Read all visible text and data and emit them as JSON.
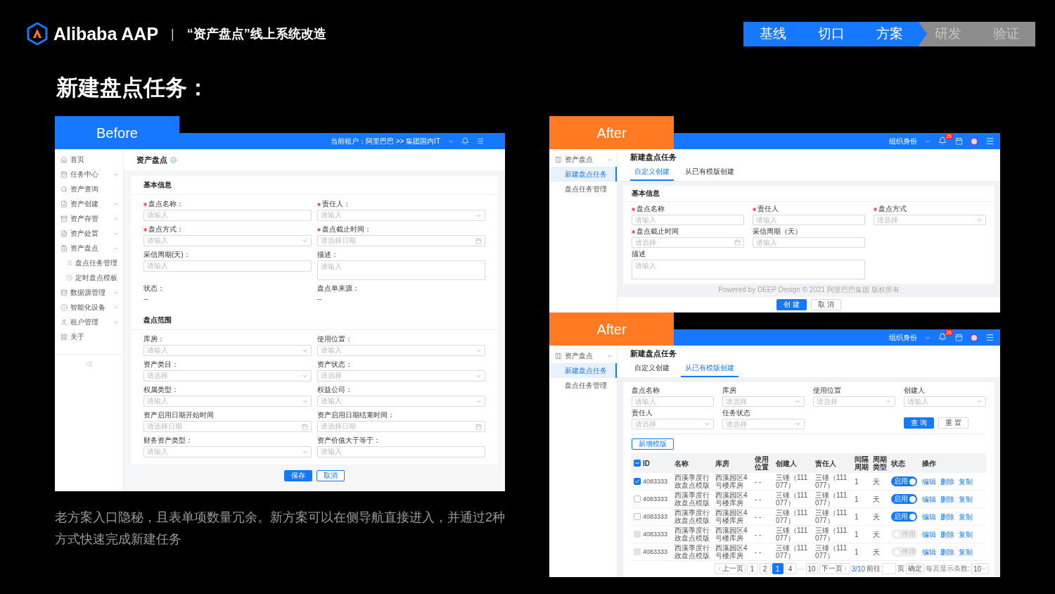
{
  "header": {
    "brand": "Alibaba AAP",
    "separator": "|",
    "project": "“资产盘点”线上系统改造",
    "steps": [
      {
        "label": "基线",
        "active": true
      },
      {
        "label": "切口",
        "active": true
      },
      {
        "label": "方案",
        "active": true
      },
      {
        "label": "研发",
        "active": false
      },
      {
        "label": "验证",
        "active": false
      }
    ]
  },
  "title": "新建盘点任务：",
  "before": {
    "badge": "Before",
    "tenant": "当前租户：阿里巴巴 >> 集团国内IT",
    "sidebar": [
      {
        "label": "首页",
        "kind": "link"
      },
      {
        "label": "任务中心",
        "kind": "group",
        "expanded": false
      },
      {
        "label": "资产查询",
        "kind": "link"
      },
      {
        "label": "资产创建",
        "kind": "group",
        "expanded": false
      },
      {
        "label": "资产存管",
        "kind": "group",
        "expanded": false
      },
      {
        "label": "资产处置",
        "kind": "group",
        "expanded": false
      },
      {
        "label": "资产盘点",
        "kind": "group",
        "expanded": true,
        "children": [
          {
            "label": "盘点任务管理",
            "kind": "link"
          },
          {
            "label": "定时盘点模板",
            "kind": "link"
          }
        ]
      },
      {
        "label": "数据源管理",
        "kind": "group",
        "expanded": false
      },
      {
        "label": "智能化设备",
        "kind": "group",
        "expanded": false
      },
      {
        "label": "租户管理",
        "kind": "group",
        "expanded": false
      },
      {
        "label": "关于",
        "kind": "link"
      }
    ],
    "page_title": "资产盘点",
    "sections": [
      {
        "title": "基本信息",
        "fields": [
          {
            "label": "盘点名称：",
            "required": true,
            "kind": "input",
            "placeholder": "请输入"
          },
          {
            "label": "责任人：",
            "required": true,
            "kind": "select",
            "placeholder": "请输入"
          },
          {
            "label": "盘点方式：",
            "required": true,
            "kind": "select",
            "placeholder": "请输入"
          },
          {
            "label": "盘点截止时间：",
            "required": true,
            "kind": "date",
            "placeholder": "请选择日期"
          },
          {
            "label": "采信周期(天)：",
            "required": false,
            "kind": "input",
            "placeholder": "请输入"
          },
          {
            "label": "描述：",
            "required": false,
            "kind": "textarea",
            "placeholder": "请输入"
          },
          {
            "label": "状态：",
            "required": false,
            "kind": "static",
            "value": "--"
          },
          {
            "label": "盘点单来源：",
            "required": false,
            "kind": "static",
            "value": "--"
          }
        ]
      },
      {
        "title": "盘点范围",
        "fields": [
          {
            "label": "库房：",
            "required": false,
            "kind": "select",
            "placeholder": "请输入"
          },
          {
            "label": "使用位置：",
            "required": false,
            "kind": "select",
            "placeholder": "请输入"
          },
          {
            "label": "资产类目：",
            "required": false,
            "kind": "select",
            "placeholder": "请选择"
          },
          {
            "label": "资产状态：",
            "required": false,
            "kind": "select",
            "placeholder": "请选择"
          },
          {
            "label": "权属类型：",
            "required": false,
            "kind": "select",
            "placeholder": "请输入"
          },
          {
            "label": "权益公司：",
            "required": false,
            "kind": "select",
            "placeholder": "请输入"
          },
          {
            "label": "资产启用日期开始时间",
            "required": false,
            "kind": "date",
            "placeholder": "请选择日期"
          },
          {
            "label": "资产启用日期结束时间：",
            "required": false,
            "kind": "date",
            "placeholder": "请选择日期"
          },
          {
            "label": "财务资产类型：",
            "required": false,
            "kind": "select",
            "placeholder": "请输入"
          },
          {
            "label": "资产价值大于等于：",
            "required": false,
            "kind": "input",
            "placeholder": "请输入"
          }
        ]
      }
    ],
    "buttons": [
      {
        "label": "保存",
        "primary": true
      },
      {
        "label": "取消",
        "primary": false
      }
    ]
  },
  "caption": "老方案入口隐秘，且表单项数量冗余。新方案可以在侧导航直接进入，并通过2种方式快速完成新建任务",
  "after_custom": {
    "badge": "After",
    "org": "组织身份",
    "notifications": "26",
    "sidebar": [
      {
        "label": "资产盘点",
        "kind": "group",
        "expanded": true,
        "children": [
          {
            "label": "新建盘点任务",
            "kind": "link",
            "selected": true
          },
          {
            "label": "盘点任务管理",
            "kind": "link",
            "selected": false
          }
        ]
      }
    ],
    "page_title": "新建盘点任务",
    "tabs": [
      {
        "label": "自定义创建",
        "selected": true
      },
      {
        "label": "从已有模版创建",
        "selected": false
      }
    ],
    "section_title": "基本信息",
    "fields": [
      {
        "label": "盘点名称",
        "required": true,
        "kind": "input",
        "placeholder": "请输入"
      },
      {
        "label": "责任人",
        "required": true,
        "kind": "input",
        "placeholder": "请输入"
      },
      {
        "label": "盘点方式",
        "required": true,
        "kind": "select",
        "placeholder": "请选择"
      },
      {
        "label": "盘点截止时间",
        "required": true,
        "kind": "date",
        "placeholder": "请选择"
      },
      {
        "label": "采信周期（天）",
        "required": false,
        "kind": "input",
        "placeholder": "请输入"
      },
      {
        "label": "描述",
        "required": false,
        "kind": "textarea",
        "placeholder": "请输入"
      }
    ],
    "footer": "Powered by  DEEP Design © 2021 阿里巴巴集团 版权所有",
    "buttons": [
      {
        "label": "创 建",
        "primary": true
      },
      {
        "label": "取 消",
        "primary": false
      }
    ]
  },
  "after_template": {
    "badge": "After",
    "org": "组织身份",
    "notifications": "26",
    "sidebar": [
      {
        "label": "资产盘点",
        "kind": "group",
        "expanded": true,
        "children": [
          {
            "label": "新建盘点任务",
            "kind": "link",
            "selected": true
          },
          {
            "label": "盘点任务管理",
            "kind": "link",
            "selected": false
          }
        ]
      }
    ],
    "page_title": "新建盘点任务",
    "tabs": [
      {
        "label": "自定义创建",
        "selected": false
      },
      {
        "label": "从已有模版创建",
        "selected": true
      }
    ],
    "filters": [
      {
        "label": "盘点名称",
        "kind": "input",
        "placeholder": "请输入"
      },
      {
        "label": "库房",
        "kind": "select",
        "placeholder": "请选择"
      },
      {
        "label": "使用位置",
        "kind": "select",
        "placeholder": "请选择"
      },
      {
        "label": "创建人",
        "kind": "select",
        "placeholder": "请输入"
      },
      {
        "label": "责任人",
        "kind": "select",
        "placeholder": "请选择"
      },
      {
        "label": "任务状态",
        "kind": "select",
        "placeholder": "请选择"
      }
    ],
    "filter_buttons": [
      {
        "label": "查 询",
        "primary": true
      },
      {
        "label": "重 置",
        "primary": false
      }
    ],
    "add_button": "新增模版",
    "table": {
      "select_all_partial": true,
      "columns": [
        "ID",
        "名称",
        "库房",
        "使用位置",
        "创建人",
        "责任人",
        "间隔周期",
        "周期类型",
        "状态",
        "操作"
      ],
      "rows": [
        {
          "checked": true,
          "disabled": false,
          "id": "4083333",
          "name": "西溪季度行政盘点模版",
          "warehouse": "西溪园区4号楼库房",
          "location": "- -",
          "creator": "三锤（111077）",
          "owner": "三锤（111077）",
          "interval": "1",
          "period": "天",
          "enabled": true,
          "status": "启用",
          "actions": [
            "编辑",
            "删除",
            "复制"
          ]
        },
        {
          "checked": false,
          "disabled": false,
          "id": "4083333",
          "name": "西溪季度行政盘点模版",
          "warehouse": "西溪园区4号楼库房",
          "location": "- -",
          "creator": "三锤（111077）",
          "owner": "三锤（111077）",
          "interval": "1",
          "period": "天",
          "enabled": true,
          "status": "启用",
          "actions": [
            "编辑",
            "删除",
            "复制"
          ]
        },
        {
          "checked": false,
          "disabled": false,
          "id": "4083333",
          "name": "西溪季度行政盘点模版",
          "warehouse": "西溪园区4号楼库房",
          "location": "- -",
          "creator": "三锤（111077）",
          "owner": "三锤（111077）",
          "interval": "1",
          "period": "天",
          "enabled": true,
          "status": "启用",
          "actions": [
            "编辑",
            "删除",
            "复制"
          ]
        },
        {
          "checked": false,
          "disabled": true,
          "id": "4083333",
          "name": "西溪季度行政盘点模版",
          "warehouse": "西溪园区4号楼库房",
          "location": "- -",
          "creator": "三锤（111077）",
          "owner": "三锤（111077）",
          "interval": "1",
          "period": "天",
          "enabled": false,
          "status": "停用",
          "actions": [
            "编辑",
            "删除",
            "复制"
          ]
        },
        {
          "checked": false,
          "disabled": true,
          "id": "4083333",
          "name": "西溪季度行政盘点模版",
          "warehouse": "西溪园区4号楼库房",
          "location": "- -",
          "creator": "三锤（111077）",
          "owner": "三锤（111077）",
          "interval": "1",
          "period": "天",
          "enabled": false,
          "status": "停用",
          "actions": [
            "编辑",
            "删除",
            "复制"
          ]
        }
      ]
    },
    "pagination": {
      "prev": "上一页",
      "pages": [
        {
          "label": "1",
          "kind": "page",
          "selected": false
        },
        {
          "label": "2",
          "kind": "page",
          "selected": false
        },
        {
          "label": "1",
          "kind": "page",
          "selected": true
        },
        {
          "label": "4",
          "kind": "page",
          "selected": false
        },
        {
          "label": "···",
          "kind": "ellipsis",
          "selected": false
        },
        {
          "label": "10",
          "kind": "page",
          "selected": false
        }
      ],
      "next": "下一页",
      "summary": "3/10",
      "goto": "前往",
      "unit": "页",
      "confirm": "确定",
      "size_label": "每页显示条数:",
      "size": "10"
    }
  }
}
